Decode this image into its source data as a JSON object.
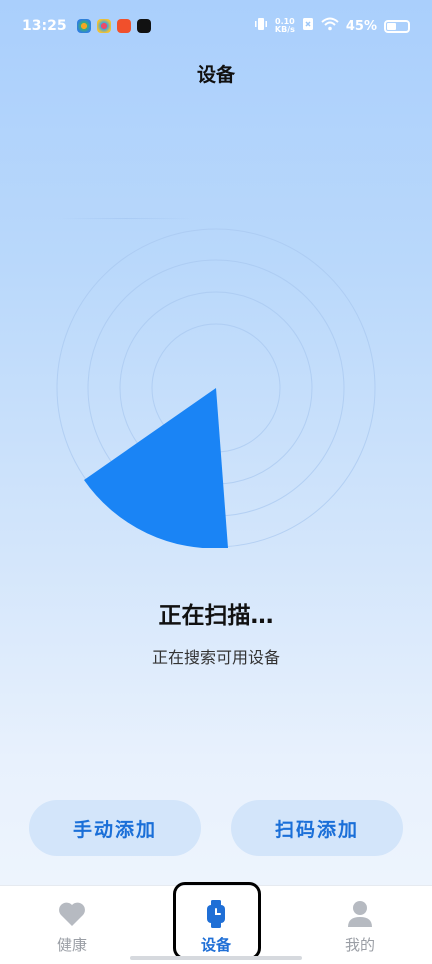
{
  "status_bar": {
    "time": "13:25",
    "net_speed_value": "0.10",
    "net_speed_unit": "KB/s",
    "battery": "45%"
  },
  "header": {
    "title": "设备"
  },
  "scan": {
    "title": "正在扫描…",
    "subtitle": "正在搜索可用设备"
  },
  "actions": {
    "manual_add": "手动添加",
    "scan_add": "扫码添加"
  },
  "tabs": [
    {
      "label": "健康",
      "icon": "heart-icon",
      "active": false
    },
    {
      "label": "设备",
      "icon": "watch-icon",
      "active": true
    },
    {
      "label": "我的",
      "icon": "person-icon",
      "active": false
    }
  ],
  "colors": {
    "accent": "#1a73e8",
    "radar_sweep": "#1a84f5",
    "button_bg": "#d3e5fa",
    "button_text": "#1a6fd8"
  }
}
